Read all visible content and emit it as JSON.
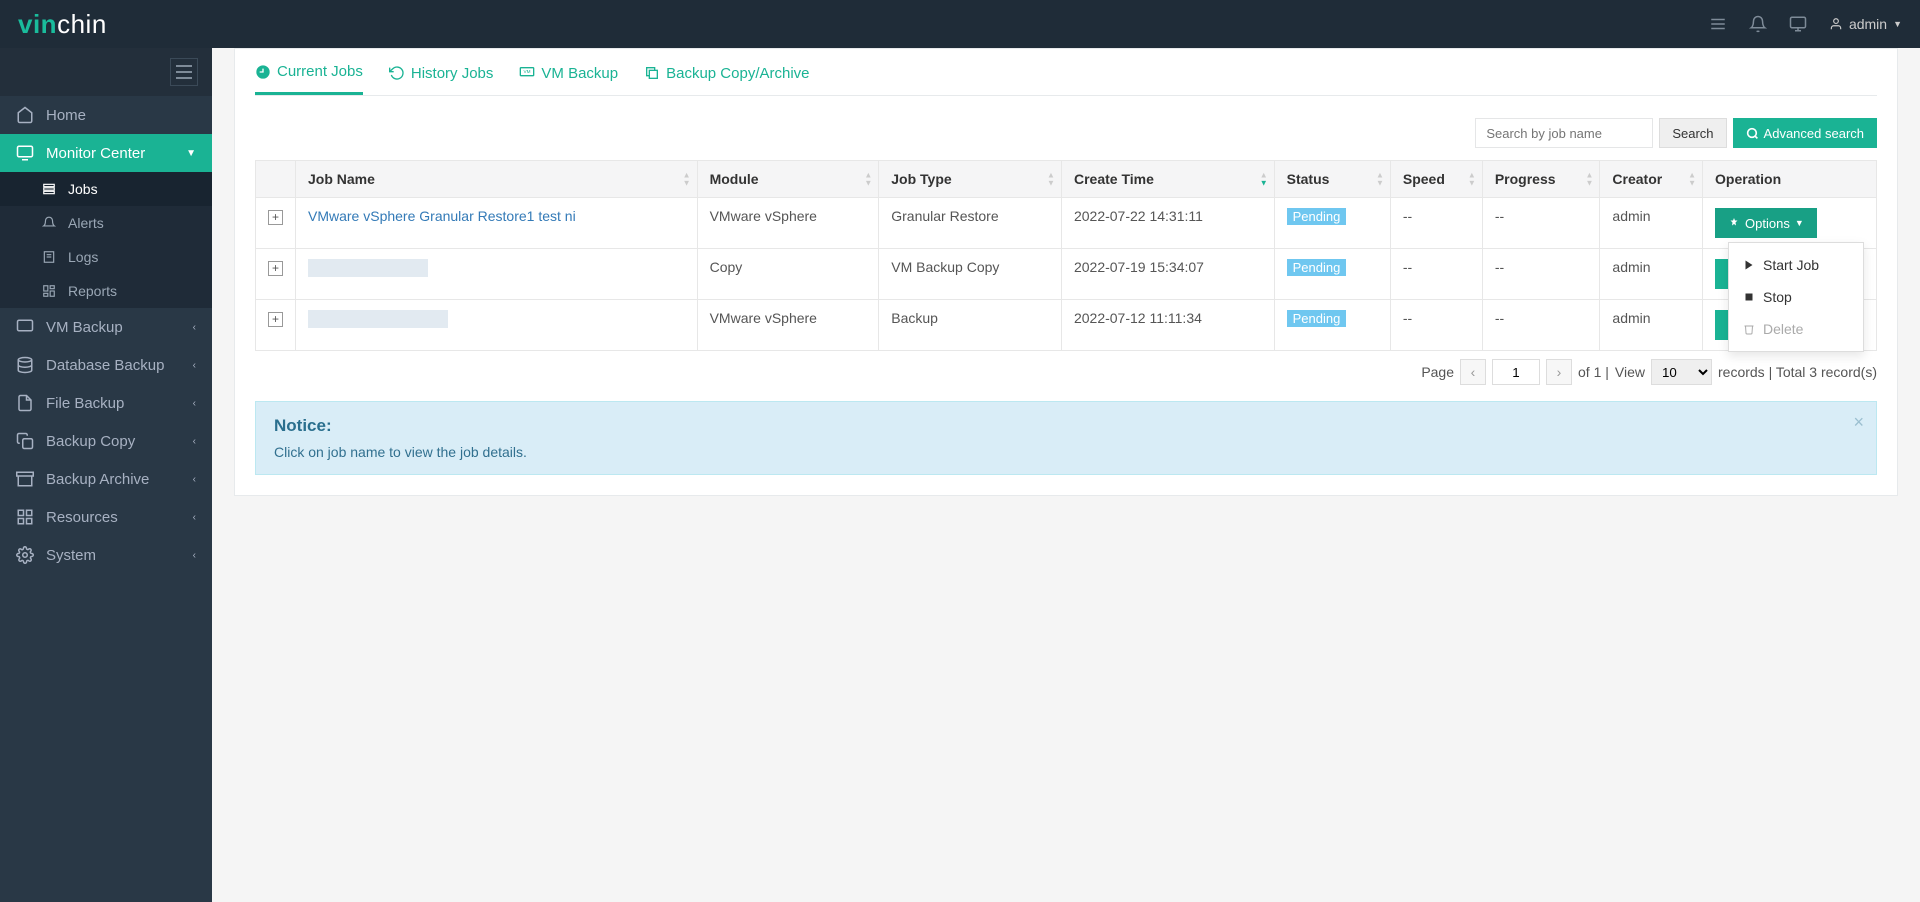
{
  "brand": {
    "prefix": "vin",
    "suffix": "chin"
  },
  "user": {
    "name": "admin"
  },
  "sidebar": {
    "items": [
      {
        "label": "Home"
      },
      {
        "label": "Monitor Center"
      },
      {
        "label": "VM Backup"
      },
      {
        "label": "Database Backup"
      },
      {
        "label": "File Backup"
      },
      {
        "label": "Backup Copy"
      },
      {
        "label": "Backup Archive"
      },
      {
        "label": "Resources"
      },
      {
        "label": "System"
      }
    ],
    "sub": [
      {
        "label": "Jobs"
      },
      {
        "label": "Alerts"
      },
      {
        "label": "Logs"
      },
      {
        "label": "Reports"
      }
    ]
  },
  "tabs": [
    {
      "label": "Current Jobs"
    },
    {
      "label": "History Jobs"
    },
    {
      "label": "VM Backup"
    },
    {
      "label": "Backup Copy/Archive"
    }
  ],
  "search": {
    "placeholder": "Search by job name",
    "button": "Search",
    "advanced": "Advanced search"
  },
  "columns": {
    "job_name": "Job Name",
    "module": "Module",
    "job_type": "Job Type",
    "create_time": "Create Time",
    "status": "Status",
    "speed": "Speed",
    "progress": "Progress",
    "creator": "Creator",
    "operation": "Operation"
  },
  "rows": [
    {
      "job_name": "VMware vSphere Granular Restore1 test ni",
      "module": "VMware vSphere",
      "job_type": "Granular Restore",
      "create_time": "2022-07-22 14:31:11",
      "status": "Pending",
      "speed": "--",
      "progress": "--",
      "creator": "admin",
      "options": "Options",
      "redacted": false
    },
    {
      "job_name": "",
      "module": "Copy",
      "job_type": "VM Backup Copy",
      "create_time": "2022-07-19 15:34:07",
      "status": "Pending",
      "speed": "--",
      "progress": "--",
      "creator": "admin",
      "options": "Options",
      "redacted": true
    },
    {
      "job_name": "",
      "module": "VMware vSphere",
      "job_type": "Backup",
      "create_time": "2022-07-12 11:11:34",
      "status": "Pending",
      "speed": "--",
      "progress": "--",
      "creator": "admin",
      "options": "Options",
      "redacted": true
    }
  ],
  "options_menu": {
    "start": "Start Job",
    "stop": "Stop",
    "delete": "Delete"
  },
  "pagination": {
    "page_label": "Page",
    "current": "1",
    "of_text": "of 1 |",
    "view_label": "View",
    "size": "10",
    "records_suffix": "records | Total 3 record(s)"
  },
  "notice": {
    "title": "Notice:",
    "text": "Click on job name to view the job details."
  }
}
